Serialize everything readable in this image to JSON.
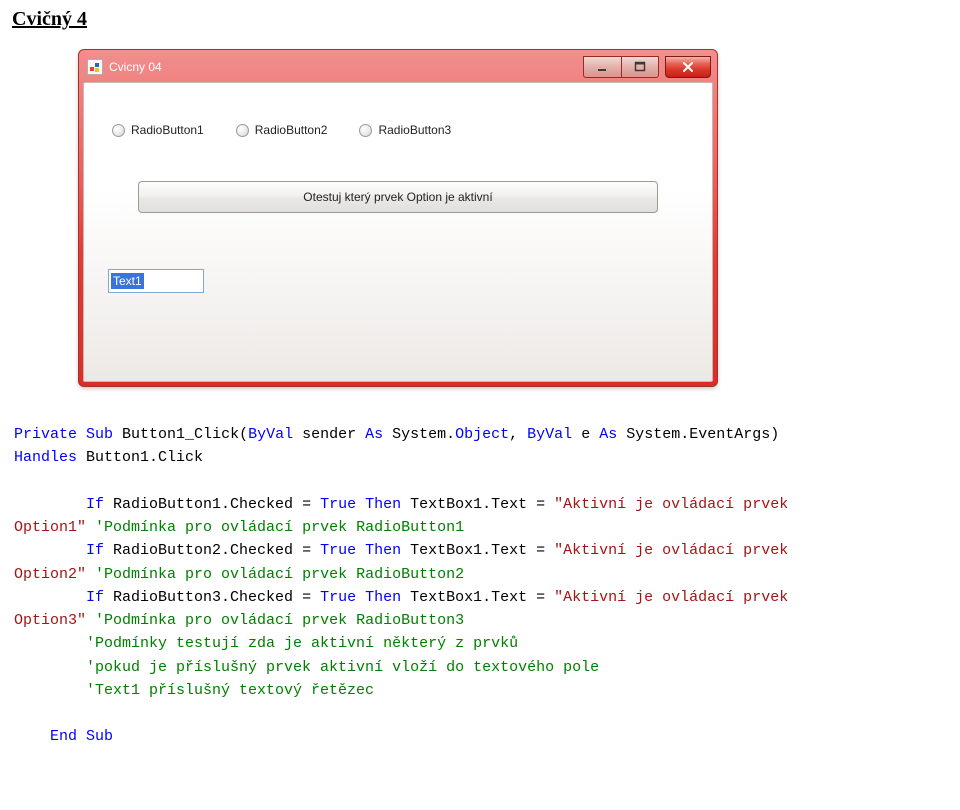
{
  "heading": "Cvičný 4",
  "window": {
    "title": "Cvicny 04",
    "radios": {
      "r1": "RadioButton1",
      "r2": "RadioButton2",
      "r3": "RadioButton3"
    },
    "button_label": "Otestuj který prvek Option je aktivní",
    "textbox_value": "Text1"
  },
  "code": {
    "l01a": "Private",
    "l01b": " ",
    "l01c": "Sub",
    "l01d": " Button1_Click(",
    "l01e": "ByVal",
    "l01f": " sender ",
    "l01g": "As",
    "l01h": " System.",
    "l01i": "Object",
    "l01j": ", ",
    "l01k": "ByVal",
    "l01l": " e ",
    "l01m": "As",
    "l01n": " System.EventArgs) ",
    "l02a": "Handles",
    "l02b": " Button1.Click",
    "l03a": "        ",
    "l03b": "If",
    "l03c": " RadioButton1.Checked = ",
    "l03d": "True",
    "l03e": " ",
    "l03f": "Then",
    "l03g": " TextBox1.Text = ",
    "l03h": "\"Aktivní je ovládací prvek ",
    "l04a": "Option1\"",
    "l04b": " ",
    "l04c": "'Podmínka pro ovládací prvek RadioButton1",
    "l05a": "        ",
    "l05b": "If",
    "l05c": " RadioButton2.Checked = ",
    "l05d": "True",
    "l05e": " ",
    "l05f": "Then",
    "l05g": " TextBox1.Text = ",
    "l05h": "\"Aktivní je ovládací prvek ",
    "l06a": "Option2\"",
    "l06b": " ",
    "l06c": "'Podmínka pro ovládací prvek RadioButton2",
    "l07a": "        ",
    "l07b": "If",
    "l07c": " RadioButton3.Checked = ",
    "l07d": "True",
    "l07e": " ",
    "l07f": "Then",
    "l07g": " TextBox1.Text = ",
    "l07h": "\"Aktivní je ovládací prvek ",
    "l08a": "Option3\"",
    "l08b": " ",
    "l08c": "'Podmínka pro ovládací prvek RadioButton3",
    "l09a": "        ",
    "l09b": "'Podmínky testují zda je aktivní některý z prvků",
    "l10a": "        ",
    "l10b": "'pokud je příslušný prvek aktivní vloží do textového pole",
    "l11a": "        ",
    "l11b": "'Text1 příslušný textový řetězec",
    "l12a": "    ",
    "l12b": "End",
    "l12c": " ",
    "l12d": "Sub"
  }
}
